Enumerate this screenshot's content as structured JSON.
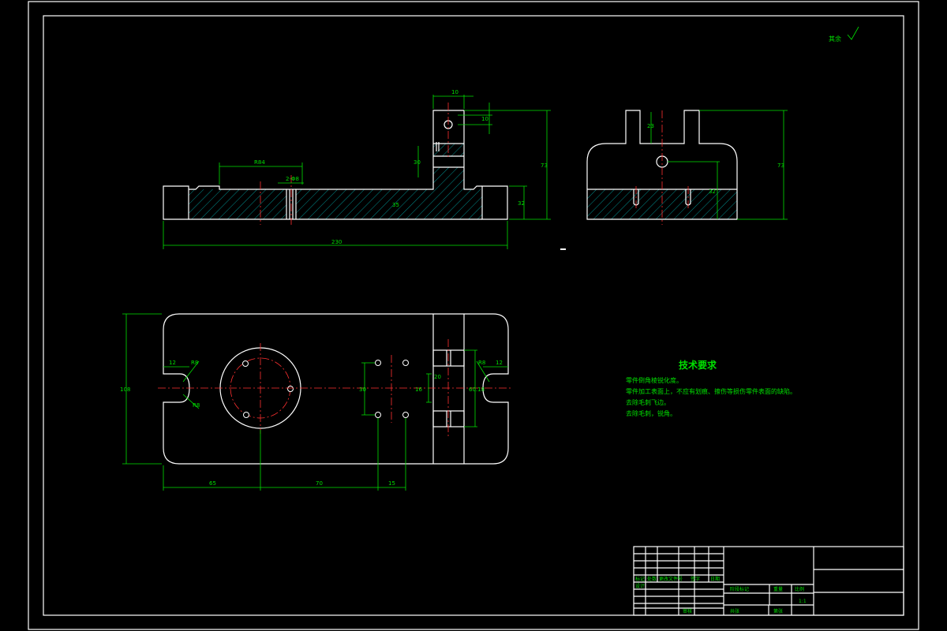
{
  "surface_finish": {
    "label": "其余"
  },
  "front_view": {
    "dims": {
      "overall_length": "230",
      "slot_length": "R84",
      "slot_width": "2-Φ8",
      "web": "35",
      "base_h": "32",
      "height": "73",
      "top_w": "10",
      "top_hole": "10",
      "mid": "30"
    }
  },
  "side_view": {
    "dims": {
      "slot": "23",
      "height": "73",
      "mid": "32"
    }
  },
  "top_view": {
    "dims": {
      "height": "108",
      "left_w": "12",
      "left_r": "R8",
      "left_phi": "R8",
      "right_w": "12",
      "right_r": "R8",
      "right_phi": "60.18",
      "bolt_span": "20",
      "center_h": "30",
      "mid_h": "16",
      "x1": "65",
      "x2": "70",
      "x3": "15"
    }
  },
  "tech_requirements": {
    "title": "技术要求",
    "items": [
      "零件倒角棱锐化度。",
      "零件加工表面上，不应有划痕、擦伤等损伤零件表面的缺陷。",
      "去除毛刺飞边。",
      "去除毛刺，锐角。"
    ]
  },
  "title_block": {
    "rows": [
      "标记",
      "处数",
      "更改文件号",
      "签字",
      "日期"
    ],
    "labels": [
      "设计",
      "审核",
      "工艺",
      "批准",
      "阶段标记",
      "重量",
      "比例",
      "共张",
      "第张"
    ],
    "scale": "1:1"
  }
}
